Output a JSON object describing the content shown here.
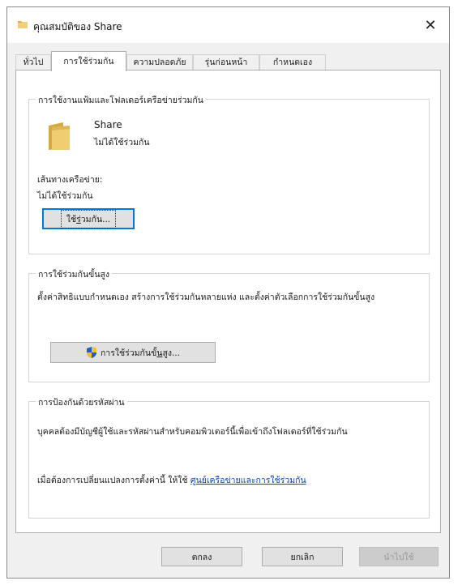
{
  "window": {
    "title": "คุณสมบัติของ Share",
    "close_glyph": "✕"
  },
  "tabs": [
    {
      "label": "ทั่วไป",
      "active": false
    },
    {
      "label": "การใช้ร่วมกัน",
      "active": true
    },
    {
      "label": "ความปลอดภัย",
      "active": false
    },
    {
      "label": "รุ่นก่อนหน้า",
      "active": false
    },
    {
      "label": "กำหนดเอง",
      "active": false
    }
  ],
  "network_sharing": {
    "group_label": "การใช้งานแฟ้มและโฟลเดอร์เครือข่ายร่วมกัน",
    "folder_name": "Share",
    "folder_status": "ไม่ได้ใช้ร่วมกัน",
    "path_label": "เส้นทางเครือข่าย:",
    "path_value": "ไม่ได้ใช้ร่วมกัน",
    "share_button": {
      "pre": "ใช้",
      "underlined": "ร่",
      "post": "วมกัน..."
    }
  },
  "advanced_sharing": {
    "group_label": "การใช้ร่วมกันขั้นสูง",
    "description": "ตั้งค่าสิทธิแบบกำหนดเอง สร้างการใช้ร่วมกันหลายแห่ง และตั้งค่าตัวเลือกการใช้ร่วมกันขั้นสูง",
    "button": {
      "pre": "การใช้ร่วมกันขั้",
      "underlined": "น",
      "post": "สูง..."
    }
  },
  "password_protection": {
    "group_label": "การป้องกันด้วยรหัสผ่าน",
    "description": "บุคคลต้องมีบัญชีผู้ใช้และรหัสผ่านสำหรับคอมพิวเตอร์นี้เพื่อเข้าถึงโฟลเดอร์ที่ใช้ร่วมกัน",
    "change_text": "เมื่อต้องการเปลี่ยนแปลงการตั้งค่านี้ ให้ใช้",
    "link_text": "ศูนย์เครือข่ายและการใช้ร่วมกัน"
  },
  "footer": {
    "ok_label": "ตกลง",
    "cancel_label": "ยกเลิก",
    "apply_label": "นำไปใช้"
  },
  "colors": {
    "accent": "#0078d7",
    "folder": "#e8c46a",
    "shield_blue": "#1f5fbf",
    "shield_yellow": "#f2c12e",
    "link": "#0645ad"
  }
}
